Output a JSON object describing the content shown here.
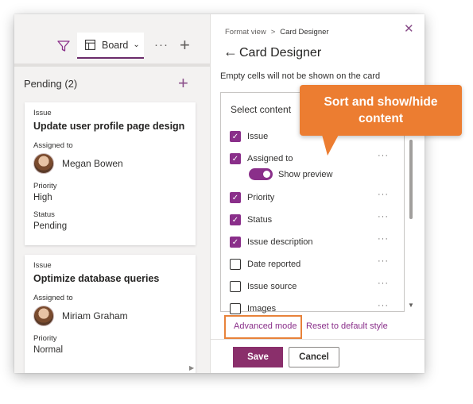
{
  "toolbar": {
    "filter_icon": "filter-icon",
    "board_label": "Board",
    "more_label": "···",
    "add_label": "+"
  },
  "group": {
    "title": "Pending (2)",
    "add_label": "+"
  },
  "cards": [
    {
      "issue_label": "Issue",
      "title": "Update user profile page design",
      "assigned_label": "Assigned to",
      "person": "Megan Bowen",
      "priority_label": "Priority",
      "priority": "High",
      "status_label": "Status",
      "status": "Pending"
    },
    {
      "issue_label": "Issue",
      "title": "Optimize database queries",
      "assigned_label": "Assigned to",
      "person": "Miriam Graham",
      "priority_label": "Priority",
      "priority": "Normal"
    }
  ],
  "panel": {
    "breadcrumb_parent": "Format view",
    "breadcrumb_sep": ">",
    "breadcrumb_current": "Card Designer",
    "close_label": "✕",
    "back_label": "←",
    "title": "Card Designer",
    "hint": "Empty cells will not be shown on the card",
    "select_content_label": "Select content",
    "fields": [
      {
        "label": "Issue",
        "checked": true,
        "dots": ""
      },
      {
        "label": "Assigned to",
        "checked": true,
        "dots": "···"
      },
      {
        "label": "Priority",
        "checked": true,
        "dots": "···"
      },
      {
        "label": "Status",
        "checked": true,
        "dots": "···"
      },
      {
        "label": "Issue description",
        "checked": true,
        "dots": "···"
      },
      {
        "label": "Date reported",
        "checked": false,
        "dots": "···"
      },
      {
        "label": "Issue source",
        "checked": false,
        "dots": "···"
      },
      {
        "label": "Images",
        "checked": false,
        "dots": "···"
      }
    ],
    "show_preview_label": "Show preview",
    "show_preview_on": true,
    "advanced_mode_label": "Advanced mode",
    "reset_label": "Reset to default style",
    "save_label": "Save",
    "cancel_label": "Cancel"
  },
  "callout": {
    "line1": "Sort and show/hide",
    "line2": "content"
  },
  "colors": {
    "accent": "#8a2f8a",
    "callout": "#ec7d31",
    "highlight_border": "#e8823a"
  }
}
